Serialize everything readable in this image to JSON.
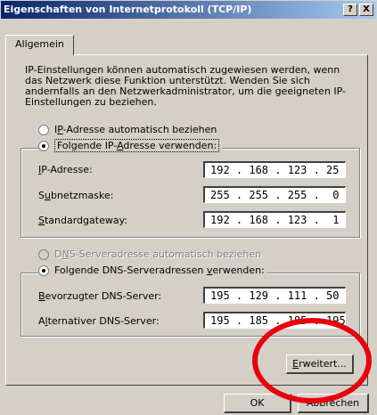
{
  "window": {
    "title": "Eigenschaften von Internetprotokoll (TCP/IP)",
    "help_label": "?",
    "close_label": "X"
  },
  "tab": {
    "label": "Allgemein"
  },
  "intro_text": "IP-Einstellungen können automatisch zugewiesen werden, wenn das Netzwerk diese Funktion unterstützt. Wenden Sie sich andernfalls an den Netzwerkadministrator, um die geeigneten IP-Einstellungen zu beziehen.",
  "ip": {
    "auto_prefix": "I",
    "auto_u": "P",
    "auto_rest": "-Adresse automatisch beziehen",
    "manual_prefix": "Folgende IP-",
    "manual_u": "A",
    "manual_rest": "dresse verwenden:",
    "address_u": "I",
    "address_rest": "P-Adresse:",
    "address_value": "192 . 168 . 123 . 25",
    "subnet_prefix": "S",
    "subnet_u": "u",
    "subnet_rest": "bnetzmaske:",
    "subnet_value": "255 . 255 . 255 .  0",
    "gateway_u": "S",
    "gateway_rest": "tandardgateway:",
    "gateway_value": "192 . 168 . 123 .  1"
  },
  "dns": {
    "auto_prefix": "D",
    "auto_u": "N",
    "auto_rest": "S-Serveradresse automatisch beziehen",
    "manual_prefix": "Folgende DNS-Serveradressen ",
    "manual_u": "v",
    "manual_rest": "erwenden:",
    "preferred_u": "B",
    "preferred_rest": "evorzugter DNS-Server:",
    "preferred_value": "195 . 129 . 111 . 50",
    "alternate_prefix": "A",
    "alternate_u": "l",
    "alternate_rest": "ternativer DNS-Server:",
    "alternate_value": "195 . 185 . 185 . 195"
  },
  "buttons": {
    "advanced_u": "E",
    "advanced_rest": "rweitert...",
    "ok": "OK",
    "cancel": "Abbrechen"
  },
  "colors": {
    "titlebar_start": "#0a246a",
    "titlebar_end": "#a6caf0",
    "window_face": "#d4d0c8",
    "highlight_circle": "#e8000d"
  }
}
